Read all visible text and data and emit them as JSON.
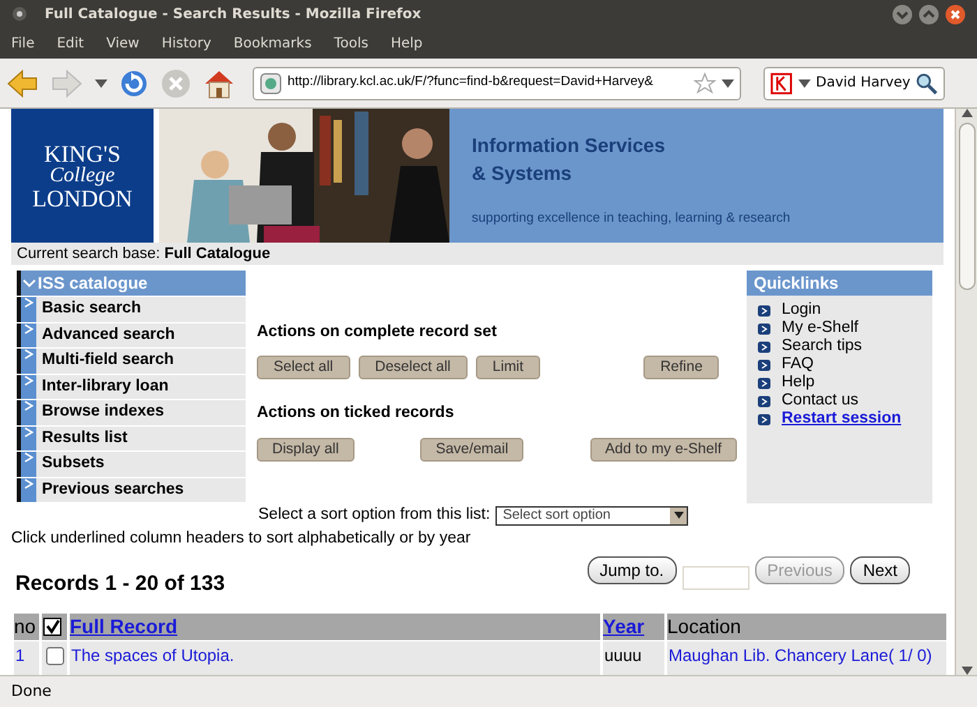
{
  "window": {
    "title": "Full Catalogue - Search Results - Mozilla Firefox"
  },
  "menu": [
    "File",
    "Edit",
    "View",
    "History",
    "Bookmarks",
    "Tools",
    "Help"
  ],
  "toolbar": {
    "address": "http://library.kcl.ac.uk/F/?func=find-b&request=David+Harvey&",
    "search": "David Harvey"
  },
  "banner": {
    "logo": [
      "KING'S",
      "College",
      "LONDON"
    ],
    "title": [
      "Information Services",
      "& Systems"
    ],
    "tagline": "supporting excellence in teaching, learning & research"
  },
  "search_base": "Current search base: **Full Catalogue**",
  "sidebar": {
    "header": "ISS catalogue",
    "expanded": true,
    "items": [
      "Basic search",
      "Advanced search",
      "Multi-field search",
      "Inter-library loan",
      "Browse indexes",
      "Results list",
      "Subsets",
      "Previous searches"
    ]
  },
  "actions": [
    {
      "title": "Actions on complete record set",
      "buttons": [
        "Select all",
        "Deselect all",
        "Limit",
        "Refine"
      ]
    },
    {
      "title": "Actions on ticked records",
      "buttons": [
        "Display all",
        "Save/email",
        "Add to my e-Shelf"
      ]
    }
  ],
  "quicklinks": {
    "title": "Quicklinks",
    "items": [
      {
        "label": "Login",
        "kind": "plain"
      },
      {
        "label": "My e-Shelf",
        "kind": "plain"
      },
      {
        "label": "Search tips",
        "kind": "plain"
      },
      {
        "label": "FAQ",
        "kind": "plain"
      },
      {
        "label": "Help",
        "kind": "plain"
      },
      {
        "label": "Contact us",
        "kind": "plain"
      },
      {
        "label": "Restart session",
        "kind": "link"
      }
    ]
  },
  "sort": {
    "label": "Select a sort option from this list:",
    "placeholder": "Select sort option"
  },
  "hint": "Click underlined column headers to sort alphabetically or by year",
  "records": "Records 1 - 20 of 133",
  "pager": [
    {
      "label": "Jump to.",
      "disabled": false
    },
    {
      "label": "Previous",
      "disabled": true
    },
    {
      "label": "Next",
      "disabled": false
    }
  ],
  "table": {
    "columns": [
      {
        "kind": "text",
        "label": "no",
        "sortable": false
      },
      {
        "kind": "checkbox",
        "checked": true
      },
      {
        "kind": "text",
        "label": "Full Record",
        "sortable": true
      },
      {
        "kind": "text",
        "label": "Year",
        "sortable": true
      },
      {
        "kind": "text",
        "label": "Location",
        "sortable": false
      }
    ],
    "rows": [
      {
        "no": "1",
        "checked": false,
        "title": "The spaces of Utopia.",
        "year": "uuuu",
        "location": "Maughan Lib. Chancery Lane( 1/ 0)"
      }
    ]
  },
  "status_bar": "Done"
}
